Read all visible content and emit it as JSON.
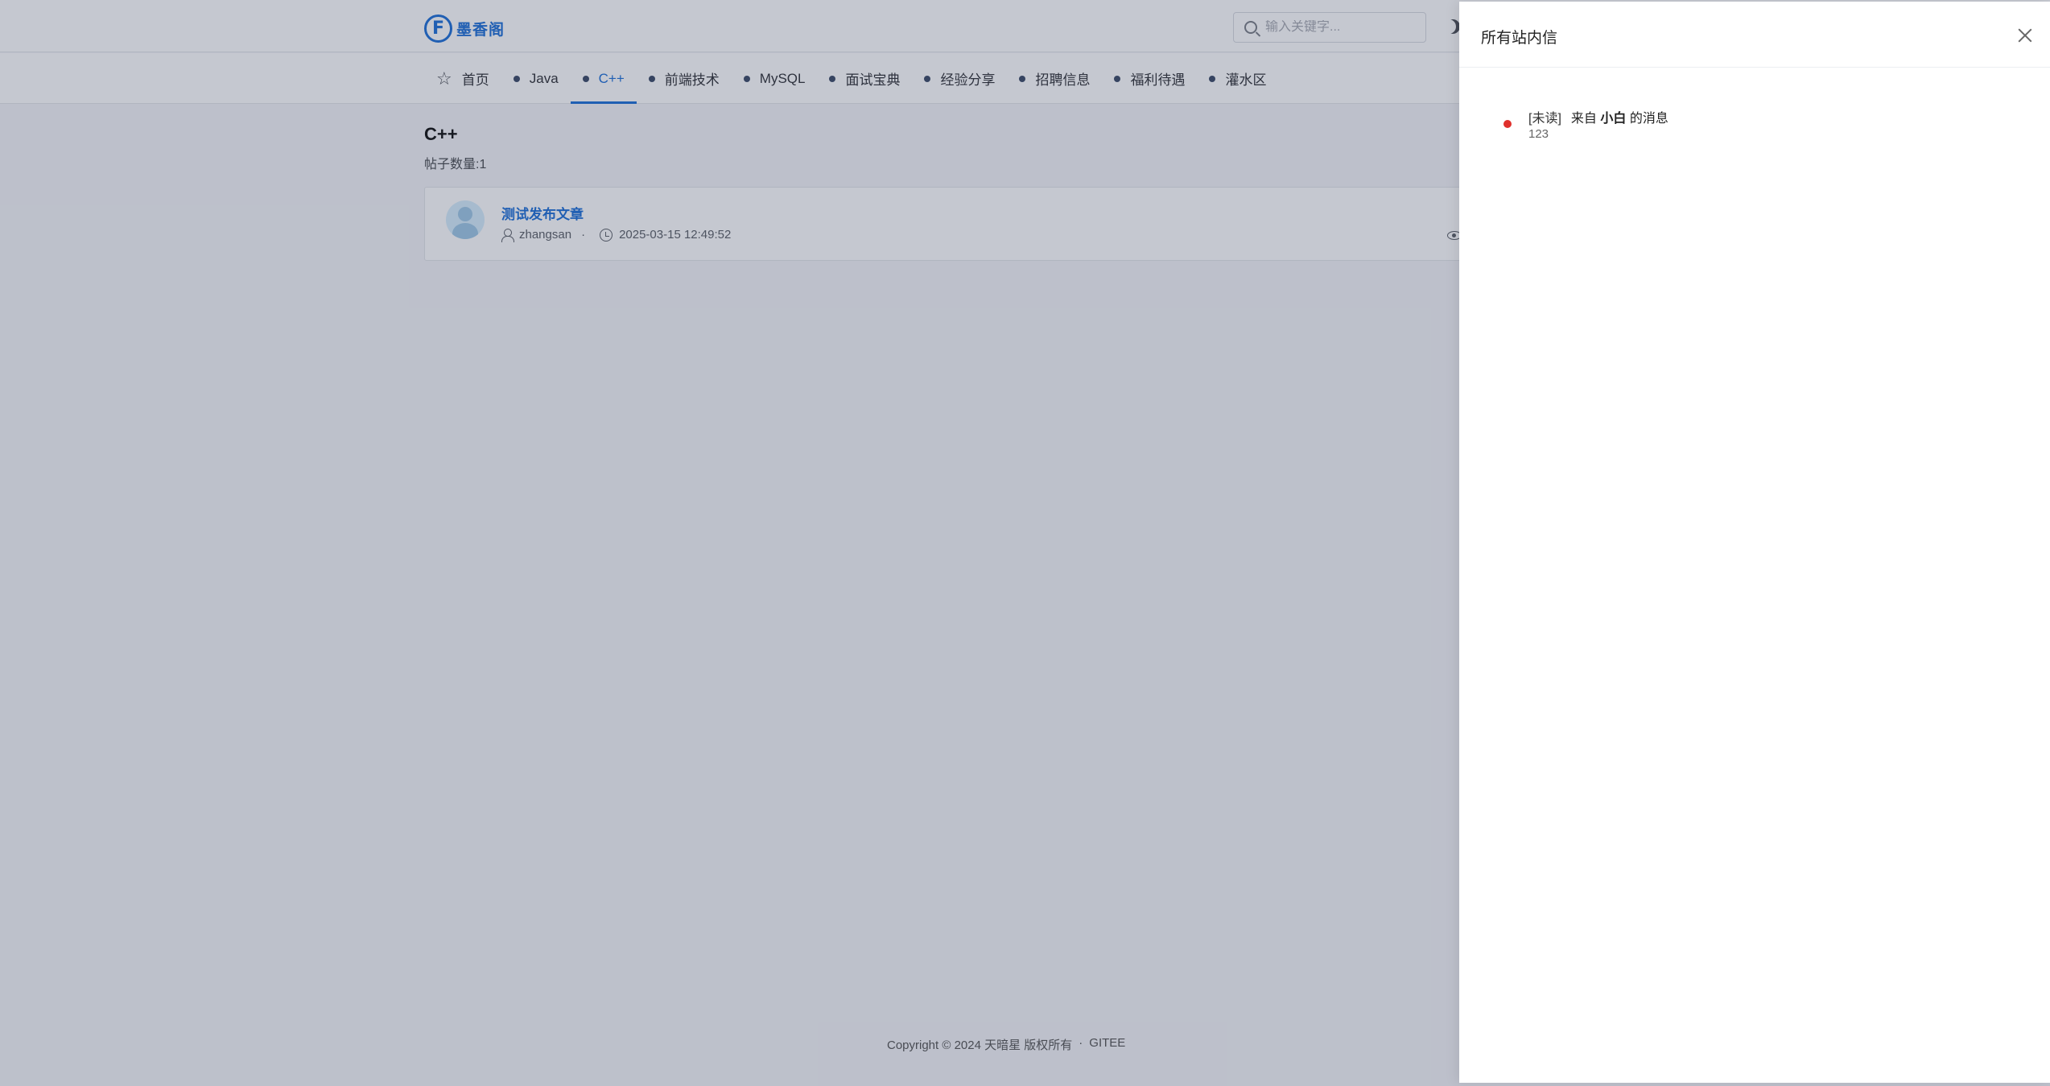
{
  "site": {
    "logo_letter": "F",
    "logo_text": "墨香阁"
  },
  "search": {
    "placeholder": "输入关键字..."
  },
  "nav": {
    "items": [
      {
        "label": "首页"
      },
      {
        "label": "Java"
      },
      {
        "label": "C++"
      },
      {
        "label": "前端技术"
      },
      {
        "label": "MySQL"
      },
      {
        "label": "面试宝典"
      },
      {
        "label": "经验分享"
      },
      {
        "label": "招聘信息"
      },
      {
        "label": "福利待遇"
      },
      {
        "label": "灌水区"
      }
    ],
    "active_index": 2
  },
  "category": {
    "title": "C++",
    "count_text": "帖子数量:1"
  },
  "posts": [
    {
      "title": "测试发布文章",
      "author": "zhangsan",
      "separator": "·",
      "datetime": "2025-03-15 12:49:52"
    }
  ],
  "footer": {
    "copyright": "Copyright © 2024 天暗星 版权所有",
    "separator": "·",
    "link": "GITEE"
  },
  "drawer": {
    "title": "所有站内信",
    "messages": [
      {
        "status": "[未读]",
        "prefix": "来自",
        "sender": "小白",
        "suffix": "的消息",
        "content": "123",
        "unread_color": "#e0302c"
      }
    ]
  },
  "colors": {
    "accent": "#1e6fd8",
    "unread": "#e0302c"
  }
}
